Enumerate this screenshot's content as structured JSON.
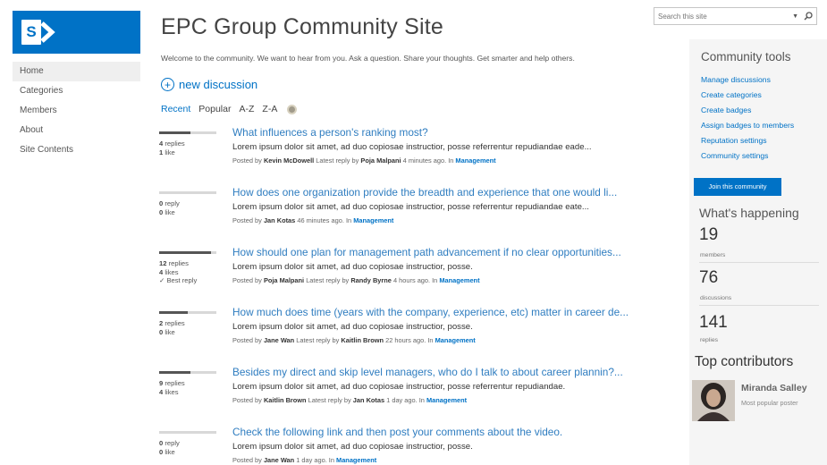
{
  "site": {
    "title": "EPC Group Community Site",
    "welcome": "Welcome to the community. We want to hear from you. Ask a question. Share your thoughts. Get smarter and help others.",
    "brand_color": "#0072c6"
  },
  "logo": {
    "letter": "S"
  },
  "nav": {
    "items": [
      {
        "label": "Home",
        "selected": true
      },
      {
        "label": "Categories"
      },
      {
        "label": "Members"
      },
      {
        "label": "About"
      },
      {
        "label": "Site Contents"
      }
    ]
  },
  "search": {
    "placeholder": "Search this site"
  },
  "new_discussion": {
    "label": "new discussion"
  },
  "sort": {
    "options": [
      "Recent",
      "Popular",
      "A-Z",
      "Z-A"
    ],
    "active": "Recent"
  },
  "discussions": [
    {
      "title": "What influences a person's ranking most?",
      "body": "Lorem ipsum dolor sit amet, ad duo copiosae instructior, posse referrentur repudiandae eade...",
      "stat1_num": "4",
      "stat1_label": "replies",
      "stat2_num": "1",
      "stat2_label": "like",
      "stat3": "",
      "activity": 0.55,
      "meta_prefix": "Posted by",
      "author": "Kevin McDowell",
      "meta_mid": "Latest reply by",
      "last": "Poja Malpani",
      "time": "4 minutes ago. In",
      "category": "Management"
    },
    {
      "title": "How does one organization provide the breadth and experience that one would li...",
      "body": "Lorem ipsum dolor sit amet, ad duo copiosae instructior, posse referrentur repudiandae eate...",
      "stat1_num": "0",
      "stat1_label": "reply",
      "stat2_num": "0",
      "stat2_label": "like",
      "stat3": "",
      "activity": 0.0,
      "meta_prefix": "Posted by",
      "author": "Jan Kotas",
      "meta_mid": "",
      "last": "",
      "time": "46 minutes ago. In",
      "category": "Management"
    },
    {
      "title": "How should one plan for management path advancement if no clear opportunities...",
      "body": "Lorem ipsum dolor sit amet, ad duo copiosae instructior, posse.",
      "stat1_num": "12",
      "stat1_label": "replies",
      "stat2_num": "4",
      "stat2_label": "likes",
      "stat3": "✓ Best reply",
      "activity": 0.9,
      "meta_prefix": "Posted by",
      "author": "Poja Malpani",
      "meta_mid": "Latest reply by",
      "last": "Randy Byrne",
      "time": "4 hours ago. In",
      "category": "Management"
    },
    {
      "title": "How much does time (years with the company, experience, etc) matter in career de...",
      "body": "Lorem ipsum dolor sit amet, ad duo copiosae instructior, posse.",
      "stat1_num": "2",
      "stat1_label": "replies",
      "stat2_num": "0",
      "stat2_label": "like",
      "stat3": "",
      "activity": 0.5,
      "meta_prefix": "Posted by",
      "author": "Jane Wan",
      "meta_mid": "Latest reply by",
      "last": "Kaitlin Brown",
      "time": "22 hours ago. In",
      "category": "Management"
    },
    {
      "title": "Besides my direct and skip level managers, who do I talk to about career plannin?...",
      "body": "Lorem ipsum dolor sit amet, ad duo copiosae instructior, posse referrentur repudiandae.",
      "stat1_num": "9",
      "stat1_label": "replies",
      "stat2_num": "4",
      "stat2_label": "likes",
      "stat3": "",
      "activity": 0.55,
      "meta_prefix": "Posted by",
      "author": "Kaitlin Brown",
      "meta_mid": "Latest reply by",
      "last": "Jan Kotas",
      "time": "1 day ago. In",
      "category": "Management"
    },
    {
      "title": "Check the following link and then post your comments about the video.",
      "body": "Lorem ipsum dolor sit amet, ad duo copiosae instructior, posse.",
      "stat1_num": "0",
      "stat1_label": "reply",
      "stat2_num": "0",
      "stat2_label": "like",
      "stat3": "",
      "activity": 0.0,
      "meta_prefix": "Posted by",
      "author": "Jane Wan",
      "meta_mid": "",
      "last": "",
      "time": "1 day ago. In",
      "category": "Management"
    }
  ],
  "community_tools": {
    "title": "Community tools",
    "links": [
      "Manage discussions",
      "Create categories",
      "Create badges",
      "Assign badges to members",
      "Reputation settings",
      "Community settings"
    ]
  },
  "join": {
    "label": "Join this community"
  },
  "happening": {
    "title": "What's happening",
    "stats": [
      {
        "value": "19",
        "label": "members"
      },
      {
        "value": "76",
        "label": "discussions"
      },
      {
        "value": "141",
        "label": "replies"
      }
    ]
  },
  "top_contributors": {
    "title": "Top contributors",
    "items": [
      {
        "name": "Miranda Salley",
        "role": "Most popular poster"
      }
    ]
  }
}
